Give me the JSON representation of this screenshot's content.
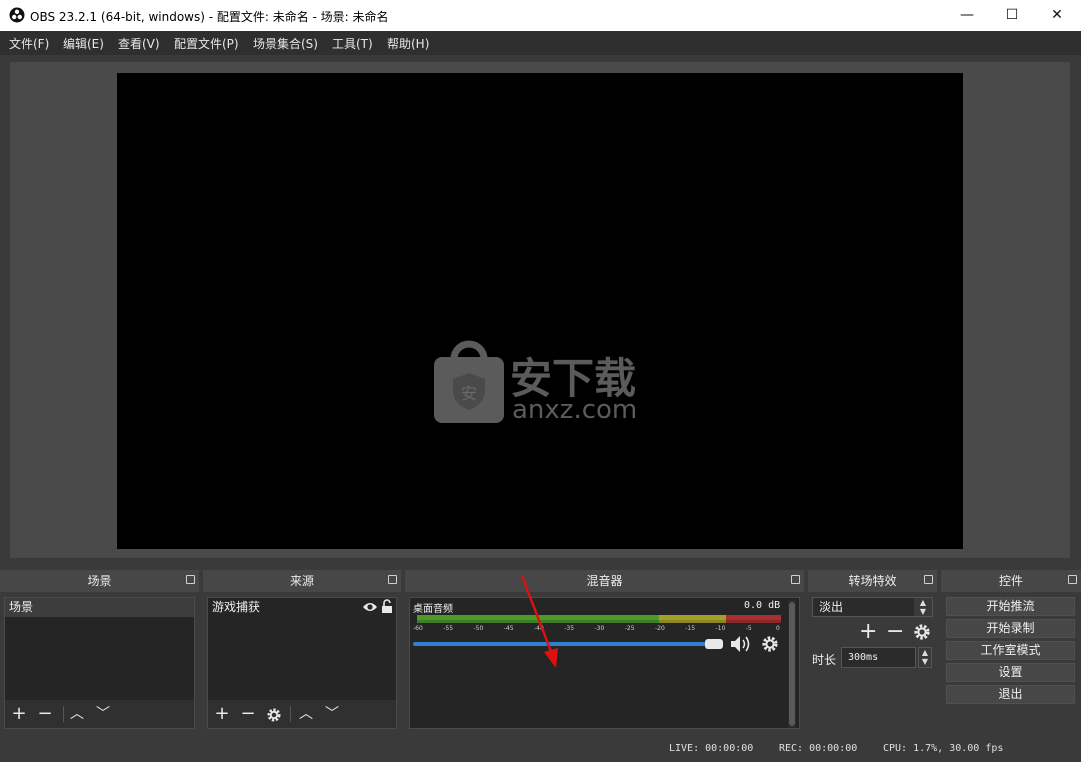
{
  "window": {
    "title": "OBS 23.2.1 (64-bit, windows) - 配置文件: 未命名 - 场景: 未命名",
    "minimize": "—",
    "maximize": "☐",
    "close": "✕"
  },
  "menu": [
    "文件(F)",
    "编辑(E)",
    "查看(V)",
    "配置文件(P)",
    "场景集合(S)",
    "工具(T)",
    "帮助(H)"
  ],
  "watermark": {
    "cn": "安下载",
    "url": "anxz.com",
    "badge": "安"
  },
  "scenes": {
    "title": "场景",
    "items": [
      "场景"
    ]
  },
  "sources": {
    "title": "来源",
    "items": [
      "游戏捕获"
    ]
  },
  "mixer": {
    "title": "混音器",
    "channel": "桌面音频",
    "level": "0.0 dB",
    "ticks": [
      "-60",
      "-55",
      "-50",
      "-45",
      "-40",
      "-35",
      "-30",
      "-25",
      "-20",
      "-15",
      "-10",
      "-5",
      "0"
    ],
    "volume_fraction": 1.0
  },
  "transitions": {
    "title": "转场特效",
    "selected": "淡出",
    "duration_label": "时长",
    "duration_value": "300ms"
  },
  "controls": {
    "title": "控件",
    "buttons": [
      "开始推流",
      "开始录制",
      "工作室模式",
      "设置",
      "退出"
    ]
  },
  "status": {
    "live": "LIVE: 00:00:00",
    "rec": "REC: 00:00:00",
    "cpu": "CPU: 1.7%, 30.00 fps"
  },
  "icons": {
    "app": "obs-logo-icon",
    "add": "+",
    "remove": "—",
    "up": "▲",
    "down": "▼",
    "gear": "gear-icon",
    "eye": "eye-icon",
    "lock": "lock-icon",
    "speaker": "speaker-icon",
    "float": "float-icon"
  },
  "colors": {
    "accent_blue": "#2f80d0",
    "meter_green": "#4c9a2a",
    "meter_yellow": "#a3a02a",
    "meter_red": "#a83030",
    "annotation_arrow": "#e01010"
  }
}
